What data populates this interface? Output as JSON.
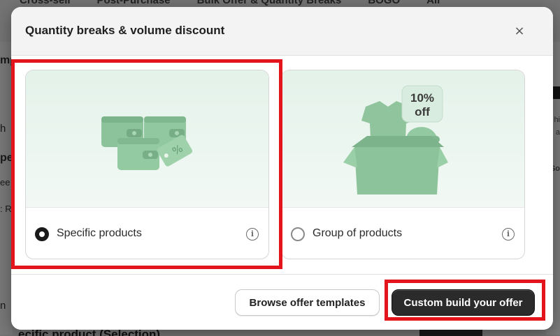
{
  "background": {
    "tabs": [
      "Cross-sell",
      "Post-Purchase",
      "Bulk Offer & Quantity Breaks",
      "BOGO",
      "All"
    ],
    "left_fragments": [
      "mp",
      "h",
      "pe",
      "ee",
      ": R",
      "n"
    ],
    "right_fragments": [
      "hi",
      "a",
      "So"
    ],
    "bottom_text": "ecific product (Selection)"
  },
  "modal": {
    "title": "Quantity breaks & volume discount",
    "close_label": "×",
    "cards": [
      {
        "label": "Specific products",
        "selected": true,
        "illustration": "green wallets with price tag",
        "info_icon": "info-icon"
      },
      {
        "label": "Group of products",
        "selected": false,
        "illustration": "green box with t-shirt, cap and clothes",
        "badge": [
          "10%",
          "off"
        ],
        "info_icon": "info-icon"
      }
    ],
    "footer": {
      "secondary_label": "Browse offer templates",
      "primary_label": "Custom build your offer"
    }
  },
  "colors": {
    "highlight": "#e3141c",
    "primary_button": "#2b2b2b",
    "illustration_green": "#8fc49c"
  }
}
